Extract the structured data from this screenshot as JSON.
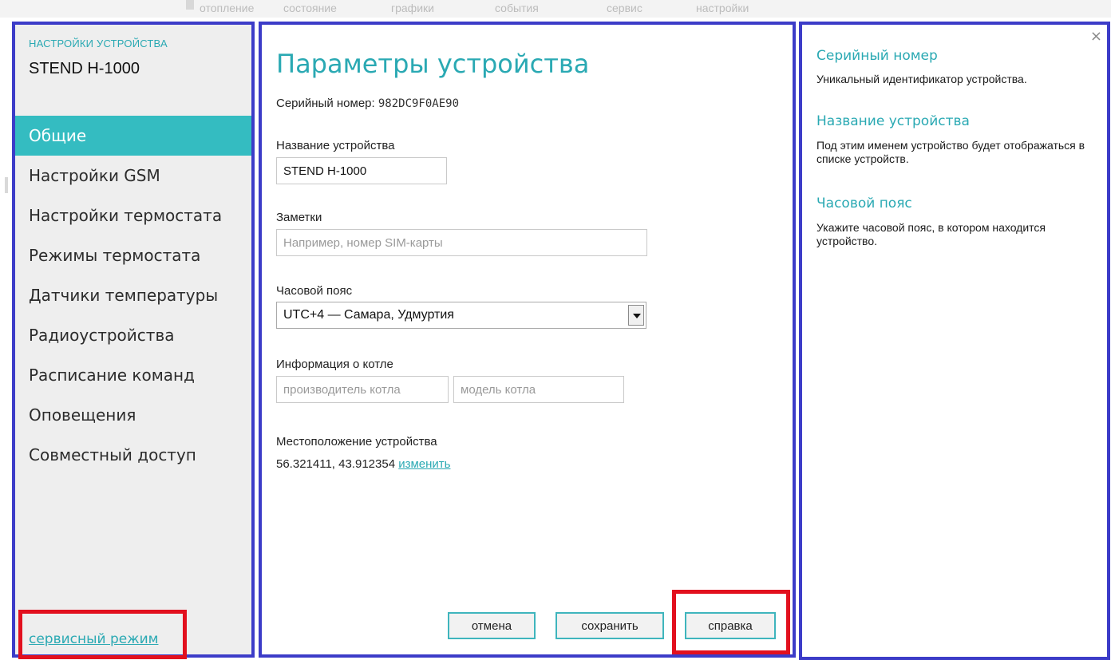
{
  "top_menu": [
    "отопление",
    "состояние",
    "графики",
    "события",
    "сервис",
    "настройки"
  ],
  "sidebar": {
    "caption": "НАСТРОЙКИ УСТРОЙСТВА",
    "device_name": "STEND H-1000",
    "items": [
      {
        "label": "Общие",
        "active": true
      },
      {
        "label": "Настройки GSM"
      },
      {
        "label": "Настройки термостата"
      },
      {
        "label": "Режимы термостата"
      },
      {
        "label": "Датчики температуры"
      },
      {
        "label": "Радиоустройства"
      },
      {
        "label": "Расписание команд"
      },
      {
        "label": "Оповещения"
      },
      {
        "label": "Совместный доступ"
      }
    ],
    "service_link": "сервисный режим"
  },
  "main": {
    "title": "Параметры устройства",
    "serial_label": "Серийный номер:",
    "serial_value": "982DC9F0AE90",
    "name_label": "Название устройства",
    "name_value": "STEND H-1000",
    "notes_label": "Заметки",
    "notes_placeholder": "Например, номер SIM-карты",
    "timezone_label": "Часовой пояс",
    "timezone_value": "UTC+4 — Самара, Удмуртия",
    "boiler_label": "Информация о котле",
    "boiler_maker_placeholder": "производитель котла",
    "boiler_model_placeholder": "модель котла",
    "location_label": "Местоположение устройства",
    "location_coords": "56.321411, 43.912354",
    "location_change": "изменить",
    "buttons": {
      "cancel": "отмена",
      "save": "сохранить",
      "help": "справка"
    }
  },
  "help": {
    "close_symbol": "×",
    "sections": [
      {
        "title": "Серийный номер",
        "text": "Уникальный идентификатор устройства."
      },
      {
        "title": "Название устройства",
        "text": "Под этим именем устройство будет отображаться в списке устройств."
      },
      {
        "title": "Часовой пояс",
        "text": "Укажите часовой пояс, в котором находится устройство."
      }
    ]
  },
  "colors": {
    "accent": "#34bcc1",
    "link": "#2aa9b3",
    "panel_border": "#3c3cc8",
    "highlight_box": "#e2101e"
  }
}
